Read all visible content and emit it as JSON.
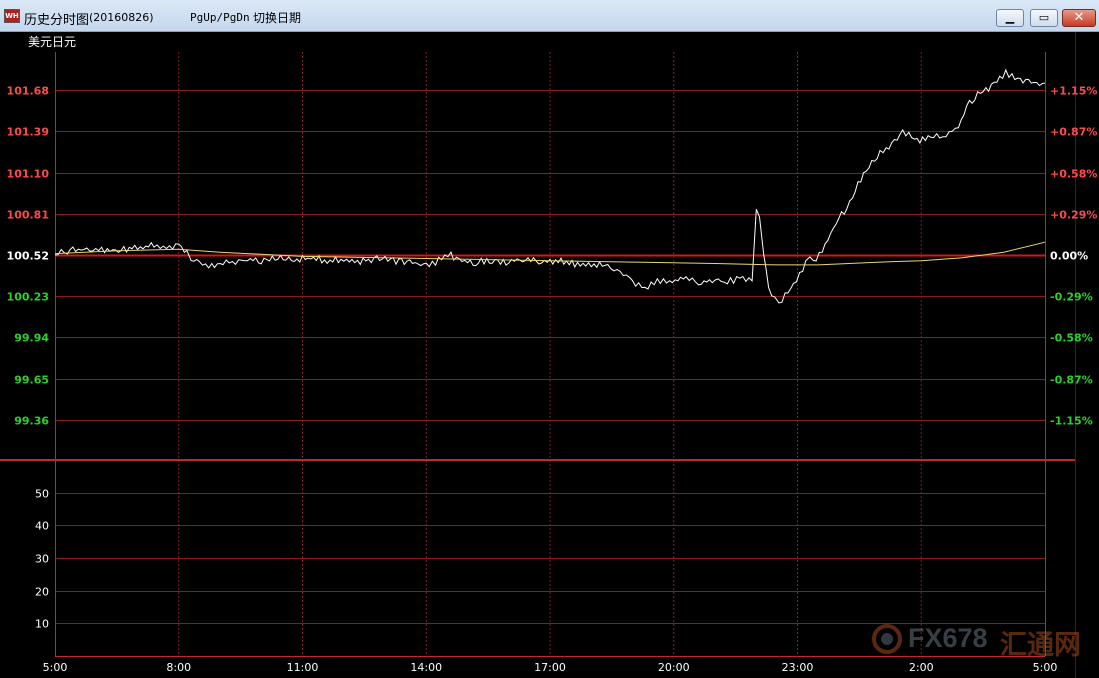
{
  "window": {
    "title": "历史分时图",
    "date": "(20160826)",
    "hint_keys": "PgUp/PgDn",
    "hint_text": "切换日期",
    "app_icon": "app-logo-icon"
  },
  "watermark": {
    "brand": "FX678",
    "brand_cn": "汇通网"
  },
  "colors": {
    "bg": "#000000",
    "grid": "#8b1c1c",
    "border": "#c0282b",
    "up": "#ff4a4a",
    "down": "#28d228",
    "neutral": "#ffffff",
    "price_line": "#ffffff",
    "avg_line": "#e8d870",
    "ref_line": "#d01818",
    "label": "#ffffff"
  },
  "chart_data": [
    {
      "type": "line",
      "title": "美元日元",
      "x_ticks": [
        "5:00",
        "8:00",
        "11:00",
        "14:00",
        "17:00",
        "20:00",
        "23:00",
        "2:00",
        "5:00"
      ],
      "x_range_hours": [
        0,
        24
      ],
      "reference_price": 100.52,
      "left_ticks": [
        "101.68",
        "101.39",
        "101.10",
        "100.81",
        "100.52",
        "100.23",
        "99.94",
        "99.65",
        "99.36"
      ],
      "right_ticks": [
        "+1.15%",
        "+0.87%",
        "+0.58%",
        "+0.29%",
        "0.00%",
        "-0.29%",
        "-0.58%",
        "-0.87%",
        "-1.15%"
      ],
      "ylim": [
        99.06,
        101.97
      ],
      "grid": true,
      "series": [
        {
          "role": "price",
          "points": [
            [
              0.0,
              100.52
            ],
            [
              0.3,
              100.55
            ],
            [
              0.7,
              100.56
            ],
            [
              1.2,
              100.55
            ],
            [
              1.6,
              100.56
            ],
            [
              2.0,
              100.57
            ],
            [
              2.4,
              100.59
            ],
            [
              2.7,
              100.57
            ],
            [
              3.0,
              100.58
            ],
            [
              3.2,
              100.54
            ],
            [
              3.3,
              100.48
            ],
            [
              3.5,
              100.47
            ],
            [
              3.8,
              100.44
            ],
            [
              4.0,
              100.46
            ],
            [
              4.3,
              100.47
            ],
            [
              4.6,
              100.49
            ],
            [
              5.0,
              100.48
            ],
            [
              5.4,
              100.5
            ],
            [
              5.8,
              100.49
            ],
            [
              6.2,
              100.5
            ],
            [
              6.6,
              100.48
            ],
            [
              7.0,
              100.49
            ],
            [
              7.4,
              100.47
            ],
            [
              7.8,
              100.5
            ],
            [
              8.2,
              100.48
            ],
            [
              8.6,
              100.47
            ],
            [
              9.0,
              100.45
            ],
            [
              9.3,
              100.48
            ],
            [
              9.6,
              100.52
            ],
            [
              9.8,
              100.48
            ],
            [
              10.2,
              100.47
            ],
            [
              10.6,
              100.48
            ],
            [
              11.0,
              100.47
            ],
            [
              11.4,
              100.49
            ],
            [
              11.8,
              100.47
            ],
            [
              12.2,
              100.48
            ],
            [
              12.6,
              100.46
            ],
            [
              13.0,
              100.46
            ],
            [
              13.4,
              100.44
            ],
            [
              13.7,
              100.4
            ],
            [
              14.0,
              100.33
            ],
            [
              14.3,
              100.29
            ],
            [
              14.6,
              100.34
            ],
            [
              14.9,
              100.32
            ],
            [
              15.3,
              100.36
            ],
            [
              15.6,
              100.33
            ],
            [
              16.0,
              100.35
            ],
            [
              16.3,
              100.33
            ],
            [
              16.6,
              100.36
            ],
            [
              16.9,
              100.34
            ],
            [
              17.0,
              100.85
            ],
            [
              17.08,
              100.79
            ],
            [
              17.18,
              100.52
            ],
            [
              17.3,
              100.28
            ],
            [
              17.45,
              100.21
            ],
            [
              17.55,
              100.18
            ],
            [
              17.7,
              100.24
            ],
            [
              17.9,
              100.3
            ],
            [
              18.05,
              100.38
            ],
            [
              18.2,
              100.46
            ],
            [
              18.3,
              100.51
            ],
            [
              18.45,
              100.48
            ],
            [
              18.6,
              100.56
            ],
            [
              18.8,
              100.67
            ],
            [
              19.0,
              100.78
            ],
            [
              19.2,
              100.85
            ],
            [
              19.4,
              100.98
            ],
            [
              19.6,
              101.08
            ],
            [
              19.8,
              101.17
            ],
            [
              20.0,
              101.24
            ],
            [
              20.15,
              101.26
            ],
            [
              20.35,
              101.32
            ],
            [
              20.55,
              101.38
            ],
            [
              20.7,
              101.36
            ],
            [
              20.9,
              101.32
            ],
            [
              21.1,
              101.34
            ],
            [
              21.3,
              101.35
            ],
            [
              21.6,
              101.37
            ],
            [
              21.9,
              101.42
            ],
            [
              22.1,
              101.57
            ],
            [
              22.3,
              101.63
            ],
            [
              22.5,
              101.68
            ],
            [
              22.7,
              101.7
            ],
            [
              22.9,
              101.76
            ],
            [
              23.05,
              101.8
            ],
            [
              23.2,
              101.78
            ],
            [
              23.4,
              101.75
            ],
            [
              23.6,
              101.74
            ],
            [
              23.8,
              101.72
            ],
            [
              24.0,
              101.73
            ]
          ]
        },
        {
          "role": "average",
          "points": [
            [
              0.0,
              100.53
            ],
            [
              1.5,
              100.55
            ],
            [
              3.0,
              100.56
            ],
            [
              4.0,
              100.54
            ],
            [
              6.0,
              100.51
            ],
            [
              8.0,
              100.5
            ],
            [
              10.0,
              100.49
            ],
            [
              12.0,
              100.48
            ],
            [
              14.0,
              100.47
            ],
            [
              16.0,
              100.46
            ],
            [
              17.5,
              100.45
            ],
            [
              18.5,
              100.45
            ],
            [
              20.0,
              100.47
            ],
            [
              21.0,
              100.48
            ],
            [
              22.0,
              100.5
            ],
            [
              23.0,
              100.54
            ],
            [
              24.0,
              100.61
            ]
          ]
        }
      ]
    },
    {
      "type": "bar",
      "y_ticks": [
        "50",
        "40",
        "30",
        "20",
        "10"
      ],
      "ylim": [
        0,
        60
      ],
      "grid": true,
      "values": []
    }
  ]
}
